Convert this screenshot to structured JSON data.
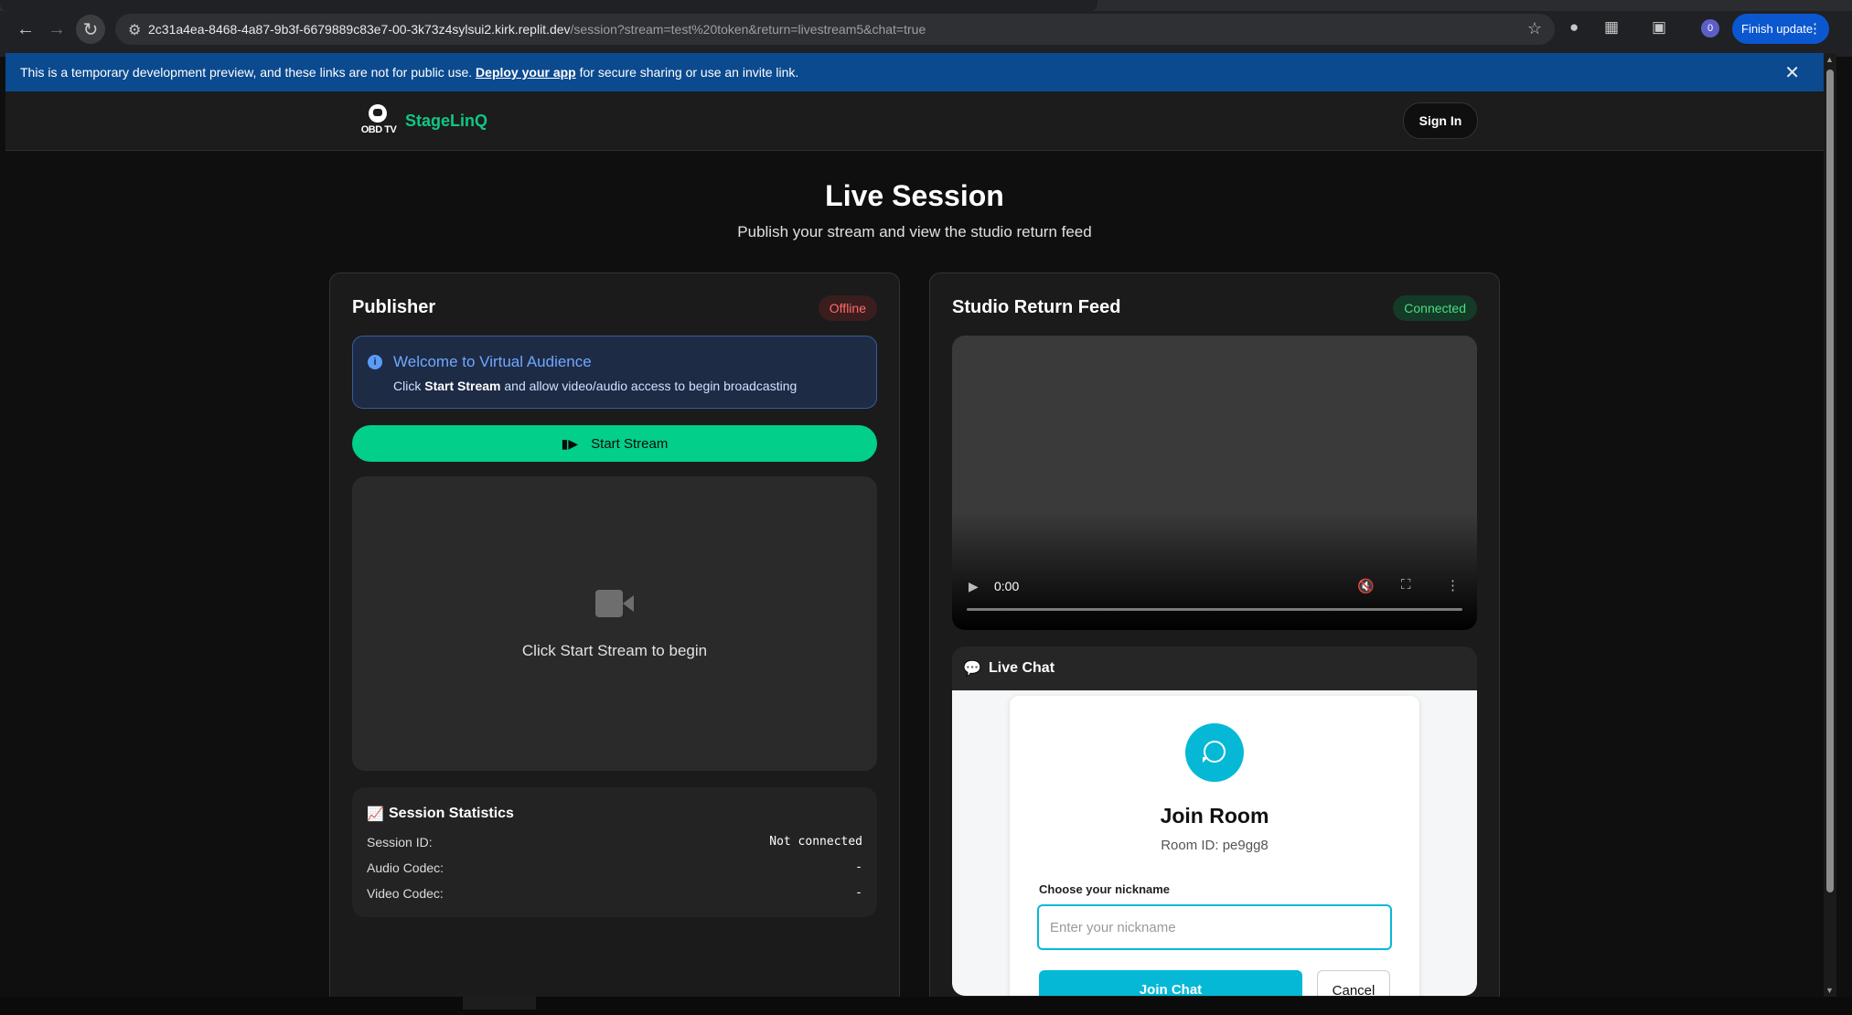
{
  "browser": {
    "url_host": "2c31a4ea-8468-4a87-9b3f-6679889c83e7-00-3k73z4sylsui2.kirk.replit.dev",
    "url_path": "/session?stream=test%20token&return=livestream5&chat=true",
    "profile_initial": "0",
    "finish_update_label": "Finish update"
  },
  "banner": {
    "text_before": "This is a temporary development preview, and these links are not for public use.",
    "link": "Deploy your app",
    "text_after": "for secure sharing or use an invite link."
  },
  "header": {
    "logo_text": "OBD TV",
    "brand": "StageLinQ",
    "signin": "Sign In"
  },
  "hero": {
    "title": "Live Session",
    "subtitle": "Publish your stream and view the studio return feed"
  },
  "publisher": {
    "title": "Publisher",
    "status": "Offline",
    "info_heading": "Welcome to Virtual Audience",
    "info_prefix": "Click",
    "info_bold": "Start Stream",
    "info_suffix": "and allow video/audio access to begin broadcasting",
    "start_button": "Start Stream",
    "preview_message": "Click Start Stream to begin",
    "stats": {
      "title": "Session Statistics",
      "rows": [
        {
          "label": "Session ID:",
          "value": "Not connected"
        },
        {
          "label": "Audio Codec:",
          "value": "-"
        },
        {
          "label": "Video Codec:",
          "value": "-"
        }
      ]
    }
  },
  "studio": {
    "title": "Studio Return Feed",
    "status": "Connected",
    "video_time": "0:00"
  },
  "chat": {
    "title": "Live Chat",
    "join_title": "Join Room",
    "room_id": "Room ID: pe9gg8",
    "nickname_label": "Choose your nickname",
    "nickname_placeholder": "Enter your nickname",
    "join_button": "Join Chat",
    "cancel_button": "Cancel"
  },
  "colors": {
    "accent": "#02cf8a",
    "brand": "#10c784",
    "chat_accent": "#05b9d6",
    "banner": "#0b4a8f"
  }
}
